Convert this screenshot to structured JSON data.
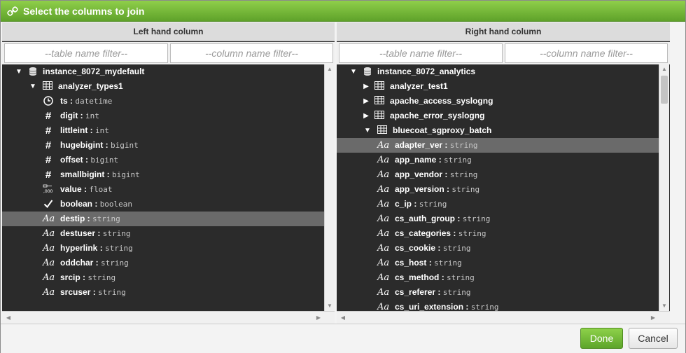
{
  "dialog": {
    "title": "Select the columns to join"
  },
  "left": {
    "header": "Left hand column",
    "table_filter_placeholder": "--table name filter--",
    "column_filter_placeholder": "--column name filter--",
    "database": "instance_8072_mydefault",
    "table": "analyzer_types1",
    "columns": [
      {
        "name": "ts",
        "type": "datetime",
        "icon": "clock-icon"
      },
      {
        "name": "digit",
        "type": "int",
        "icon": "hash-icon"
      },
      {
        "name": "littleint",
        "type": "int",
        "icon": "hash-icon"
      },
      {
        "name": "hugebigint",
        "type": "bigint",
        "icon": "hash-icon"
      },
      {
        "name": "offset",
        "type": "bigint",
        "icon": "hash-icon"
      },
      {
        "name": "smallbigint",
        "type": "bigint",
        "icon": "hash-icon"
      },
      {
        "name": "value",
        "type": "float",
        "icon": "float-icon"
      },
      {
        "name": "boolean",
        "type": "boolean",
        "icon": "checkmark-icon"
      },
      {
        "name": "destip",
        "type": "string",
        "icon": "text-type-icon",
        "selected": true
      },
      {
        "name": "destuser",
        "type": "string",
        "icon": "text-type-icon"
      },
      {
        "name": "hyperlink",
        "type": "string",
        "icon": "text-type-icon"
      },
      {
        "name": "oddchar",
        "type": "string",
        "icon": "text-type-icon"
      },
      {
        "name": "srcip",
        "type": "string",
        "icon": "text-type-icon"
      },
      {
        "name": "srcuser",
        "type": "string",
        "icon": "text-type-icon"
      }
    ]
  },
  "right": {
    "header": "Right hand column",
    "table_filter_placeholder": "--table name filter--",
    "column_filter_placeholder": "--column name filter--",
    "database": "instance_8072_analytics",
    "collapsed_tables": [
      "analyzer_test1",
      "apache_access_syslogng",
      "apache_error_syslogng"
    ],
    "table": "bluecoat_sgproxy_batch",
    "columns": [
      {
        "name": "adapter_ver",
        "type": "string",
        "selected": true
      },
      {
        "name": "app_name",
        "type": "string"
      },
      {
        "name": "app_vendor",
        "type": "string"
      },
      {
        "name": "app_version",
        "type": "string"
      },
      {
        "name": "c_ip",
        "type": "string"
      },
      {
        "name": "cs_auth_group",
        "type": "string"
      },
      {
        "name": "cs_categories",
        "type": "string"
      },
      {
        "name": "cs_cookie",
        "type": "string"
      },
      {
        "name": "cs_host",
        "type": "string"
      },
      {
        "name": "cs_method",
        "type": "string"
      },
      {
        "name": "cs_referer",
        "type": "string"
      },
      {
        "name": "cs_uri_extension",
        "type": "string"
      }
    ]
  },
  "footer": {
    "done_label": "Done",
    "cancel_label": "Cancel"
  },
  "colors": {
    "accent": "#6db133",
    "panel_bg": "#2b2b2b",
    "selected_row": "#6a6a6a"
  }
}
